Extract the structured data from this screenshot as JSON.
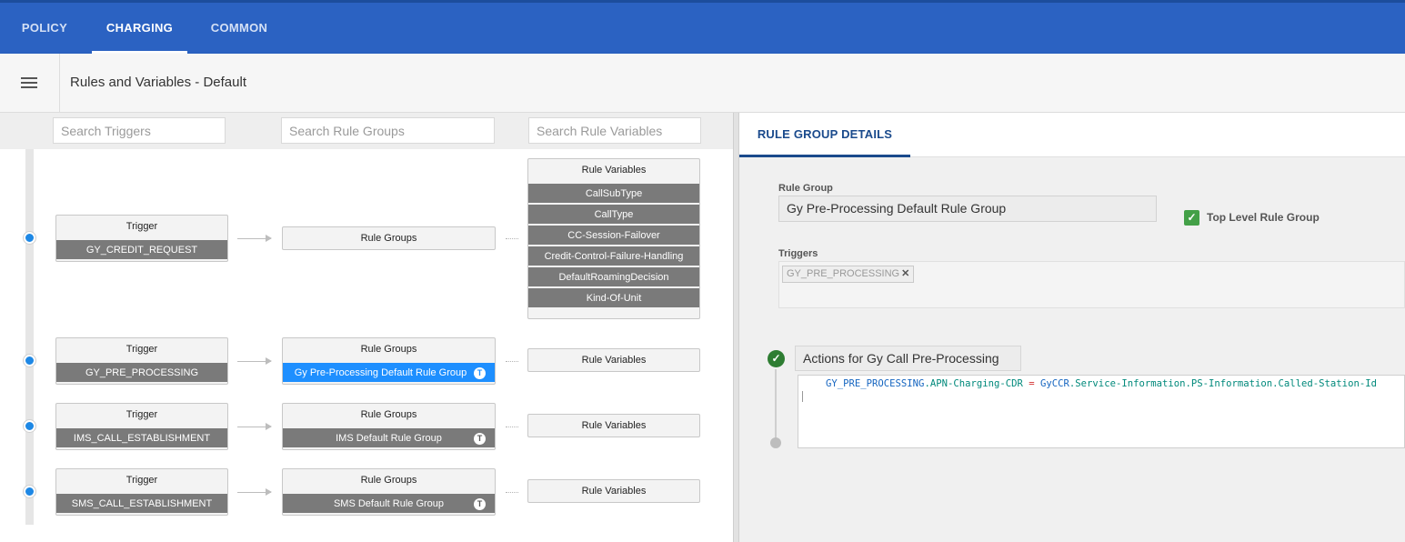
{
  "topnav": {
    "tabs": [
      {
        "label": "POLICY",
        "active": false
      },
      {
        "label": "CHARGING",
        "active": true
      },
      {
        "label": "COMMON",
        "active": false
      }
    ],
    "color": "#2b62c2"
  },
  "header": {
    "title": "Rules and Variables - Default",
    "menu_icon": "hamburger-menu-icon"
  },
  "search": {
    "triggers_placeholder": "Search Triggers",
    "rule_groups_placeholder": "Search Rule Groups",
    "rule_variables_placeholder": "Search Rule Variables"
  },
  "flows": [
    {
      "trigger_header": "Trigger",
      "trigger": "GY_CREDIT_REQUEST",
      "rule_groups_header": "Rule Groups",
      "rule_group": null,
      "rule_variables_header": "Rule Variables",
      "rule_variables": [
        "CallSubType",
        "CallType",
        "CC-Session-Failover",
        "Credit-Control-Failure-Handling",
        "DefaultRoamingDecision",
        "Kind-Of-Unit"
      ]
    },
    {
      "trigger_header": "Trigger",
      "trigger": "GY_PRE_PROCESSING",
      "rule_groups_header": "Rule Groups",
      "rule_group": "Gy Pre-Processing Default Rule Group",
      "rule_group_badge": "T",
      "selected": true,
      "rule_variables_header": "Rule Variables",
      "rule_variables": []
    },
    {
      "trigger_header": "Trigger",
      "trigger": "IMS_CALL_ESTABLISHMENT",
      "rule_groups_header": "Rule Groups",
      "rule_group": "IMS Default Rule Group",
      "rule_group_badge": "T",
      "rule_variables_header": "Rule Variables",
      "rule_variables": []
    },
    {
      "trigger_header": "Trigger",
      "trigger": "SMS_CALL_ESTABLISHMENT",
      "rule_groups_header": "Rule Groups",
      "rule_group": "SMS Default Rule Group",
      "rule_group_badge": "T",
      "rule_variables_header": "Rule Variables",
      "rule_variables": []
    }
  ],
  "details": {
    "tab_label": "RULE GROUP DETAILS",
    "rule_group_label": "Rule Group",
    "rule_group_value": "Gy Pre-Processing Default Rule Group",
    "top_level_label": "Top Level Rule Group",
    "top_level_checked": true,
    "triggers_label": "Triggers",
    "trigger_chip": "GY_PRE_PROCESSING",
    "actions_title": "Actions for Gy Call Pre-Processing",
    "code": {
      "var": "GY_PRE_PROCESSING",
      "dot1": ".",
      "prop": "APN-Charging-CDR",
      "op": " = ",
      "rhs_var": "GyCCR",
      "rhs_prop": ".Service-Information.PS-Information.Called-Station-Id"
    }
  },
  "colors": {
    "accent": "#2b62c2",
    "selected": "#1e8fff",
    "item_bg": "#7a7a7a",
    "check": "#43a047"
  }
}
